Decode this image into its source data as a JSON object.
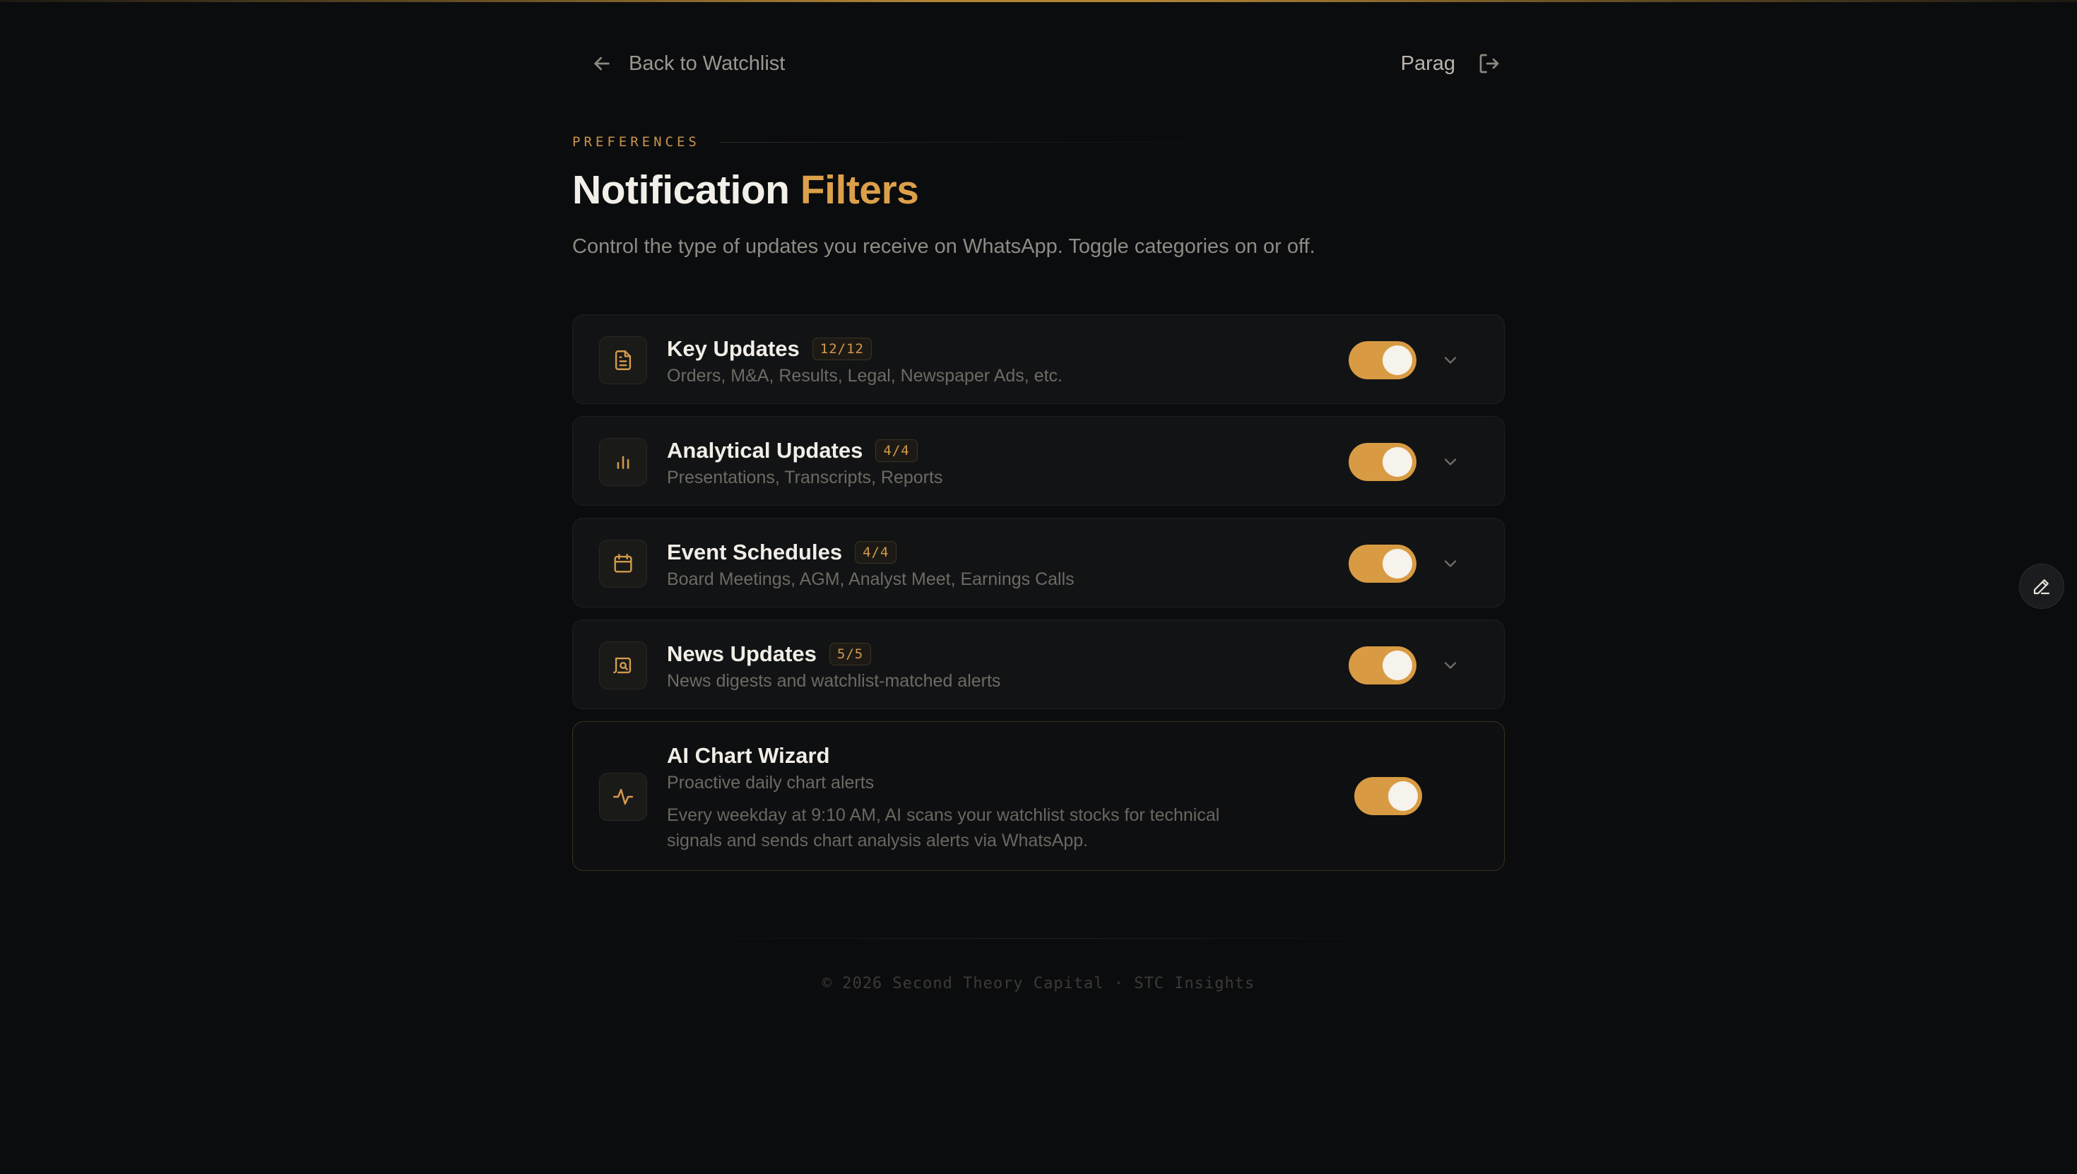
{
  "header": {
    "back_label": "Back to Watchlist",
    "user_name": "Parag"
  },
  "eyebrow": "PREFERENCES",
  "title": {
    "main": "Notification",
    "accent": "Filters"
  },
  "subtitle": "Control the type of updates you receive on WhatsApp. Toggle categories on or off.",
  "categories": [
    {
      "name": "Key Updates",
      "badge": "12/12",
      "desc": "Orders, M&A, Results, Legal, Newspaper Ads, etc.",
      "icon": "document-icon",
      "enabled": true
    },
    {
      "name": "Analytical Updates",
      "badge": "4/4",
      "desc": "Presentations, Transcripts, Reports",
      "icon": "bar-chart-icon",
      "enabled": true
    },
    {
      "name": "Event Schedules",
      "badge": "4/4",
      "desc": "Board Meetings, AGM, Analyst Meet, Earnings Calls",
      "icon": "calendar-icon",
      "enabled": true
    },
    {
      "name": "News Updates",
      "badge": "5/5",
      "desc": "News digests and watchlist-matched alerts",
      "icon": "newspaper-icon",
      "enabled": true
    }
  ],
  "wizard": {
    "name": "AI Chart Wizard",
    "desc": "Proactive daily chart alerts",
    "long": "Every weekday at 9:10 AM, AI scans your watchlist stocks for technical signals and sends chart analysis alerts via WhatsApp.",
    "icon": "activity-icon",
    "enabled": true
  },
  "footer": "© 2026 Second Theory Capital · STC Insights",
  "colors": {
    "accent": "#d89b43",
    "background": "#0b0c0e"
  }
}
